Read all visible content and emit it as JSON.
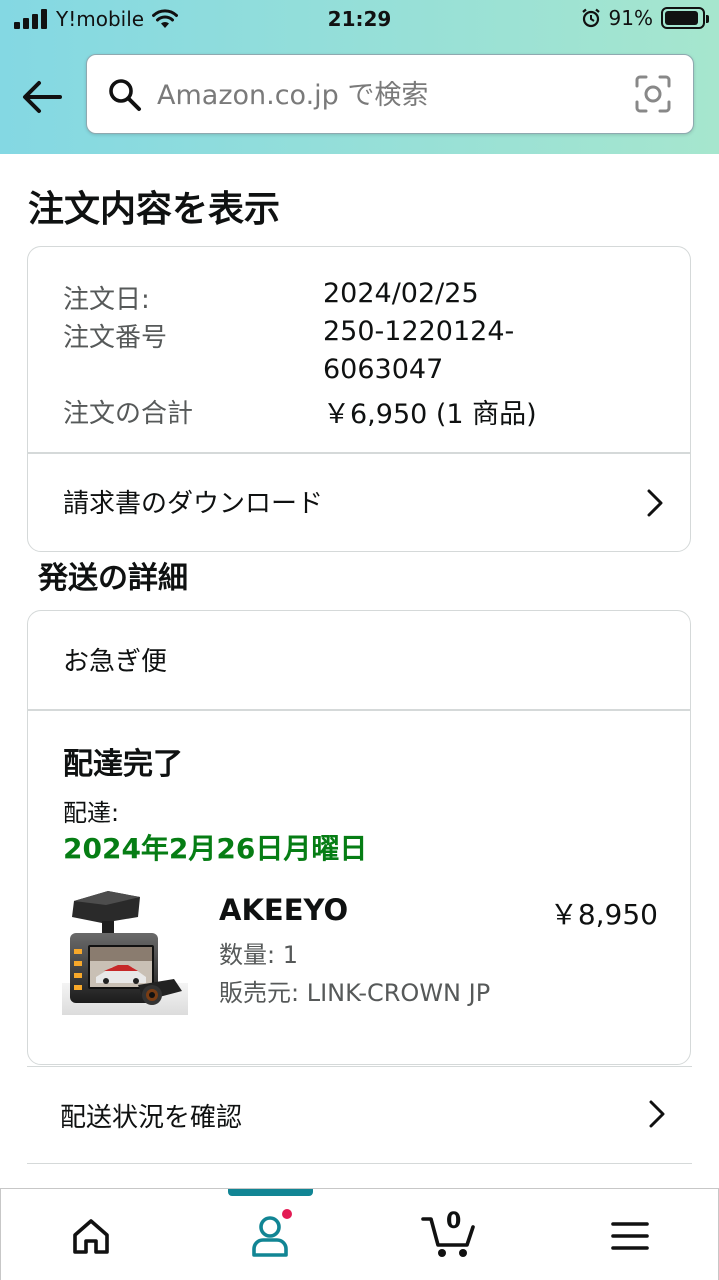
{
  "status_bar": {
    "carrier": "Y!mobile",
    "time": "21:29",
    "battery": "91%",
    "battery_level": 0.91
  },
  "search": {
    "placeholder": "Amazon.co.jp で検索"
  },
  "page": {
    "title": "注文内容を表示"
  },
  "order_summary": {
    "date_label": "注文日:",
    "date_value": "2024/02/25",
    "number_label": "注文番号",
    "number_value_line1": "250-1220124-",
    "number_value_line2": "6063047",
    "total_label": "注文の合計",
    "total_value": "￥6,950 (1 商品)",
    "invoice_link": "請求書のダウンロード"
  },
  "shipment": {
    "section_title": "発送の詳細",
    "method": "お急ぎ便",
    "status_title": "配達完了",
    "delivery_label": "配達:",
    "delivery_date": "2024年2月26日月曜日",
    "item": {
      "name": "AKEEYO",
      "price": "￥8,950",
      "quantity": "数量: 1",
      "seller": "販売元: LINK-CROWN JP"
    },
    "track_link": "配送状況を確認"
  },
  "bottom_nav": {
    "cart_count": "0",
    "active_color": "#118594",
    "notification_color": "#e31b54"
  },
  "colors": {
    "delivered_green": "#067d14",
    "header_gradient_start": "#84d8e3",
    "header_gradient_end": "#a6e6ce"
  }
}
